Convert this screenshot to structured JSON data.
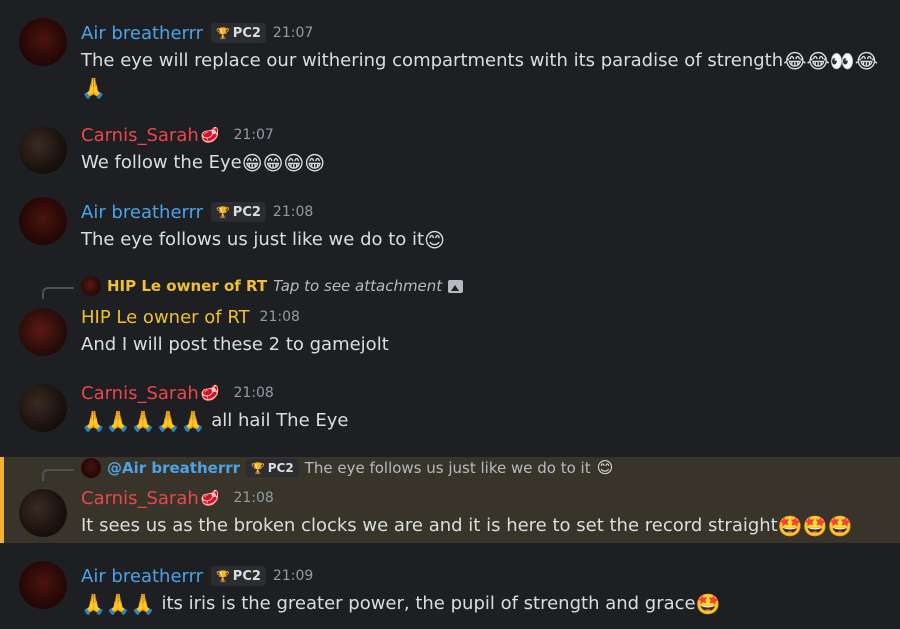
{
  "messages": [
    {
      "author": "Air breatherrr",
      "tag": "PC2",
      "time": "21:07",
      "text": "The eye will replace our withering compartments with its paradise of strength",
      "emojis": "😂😂👀😂",
      "line2": "🙏"
    },
    {
      "author": "Carnis_Sarah",
      "author_emoji": "🥩",
      "time": "21:07",
      "text": "We follow the Eye",
      "emojis": "😁😁😁😁"
    },
    {
      "author": "Air breatherrr",
      "tag": "PC2",
      "time": "21:08",
      "text": "The eye follows us just like we do to it",
      "emojis": "😊"
    },
    {
      "reply_author": "HIP Le owner of RT",
      "reply_text": "Tap to see attachment",
      "author": "HIP Le owner of RT",
      "time": "21:08",
      "text": "And I will post these 2 to gamejolt"
    },
    {
      "author": "Carnis_Sarah",
      "author_emoji": "🥩",
      "time": "21:08",
      "emojis": "🙏🙏🙏🙏🙏",
      "text": "all hail The Eye"
    },
    {
      "reply_author": "@Air breatherrr",
      "reply_tag": "PC2",
      "reply_text": "The eye follows us just like we do to it",
      "reply_emoji": "😊",
      "author": "Carnis_Sarah",
      "author_emoji": "🥩",
      "time": "21:08",
      "text": "It sees us as the broken clocks we are and it is here to set the record straight",
      "emojis": "🤩🤩🤩"
    },
    {
      "author": "Air breatherrr",
      "tag": "PC2",
      "time": "21:09",
      "emojis": "🙏🙏🙏",
      "text": "its iris is the greater power, the pupil of strength and grace",
      "emojis_end": "🤩"
    }
  ],
  "icons": {
    "trophy": "🏆"
  },
  "colors": {
    "background": "#1e1f22",
    "air_name": "#4ba3e8",
    "carnis_name": "#e8484c",
    "hip_name": "#f0c030",
    "mention_highlight": "#38342a",
    "mention_bar": "#f0b232"
  }
}
